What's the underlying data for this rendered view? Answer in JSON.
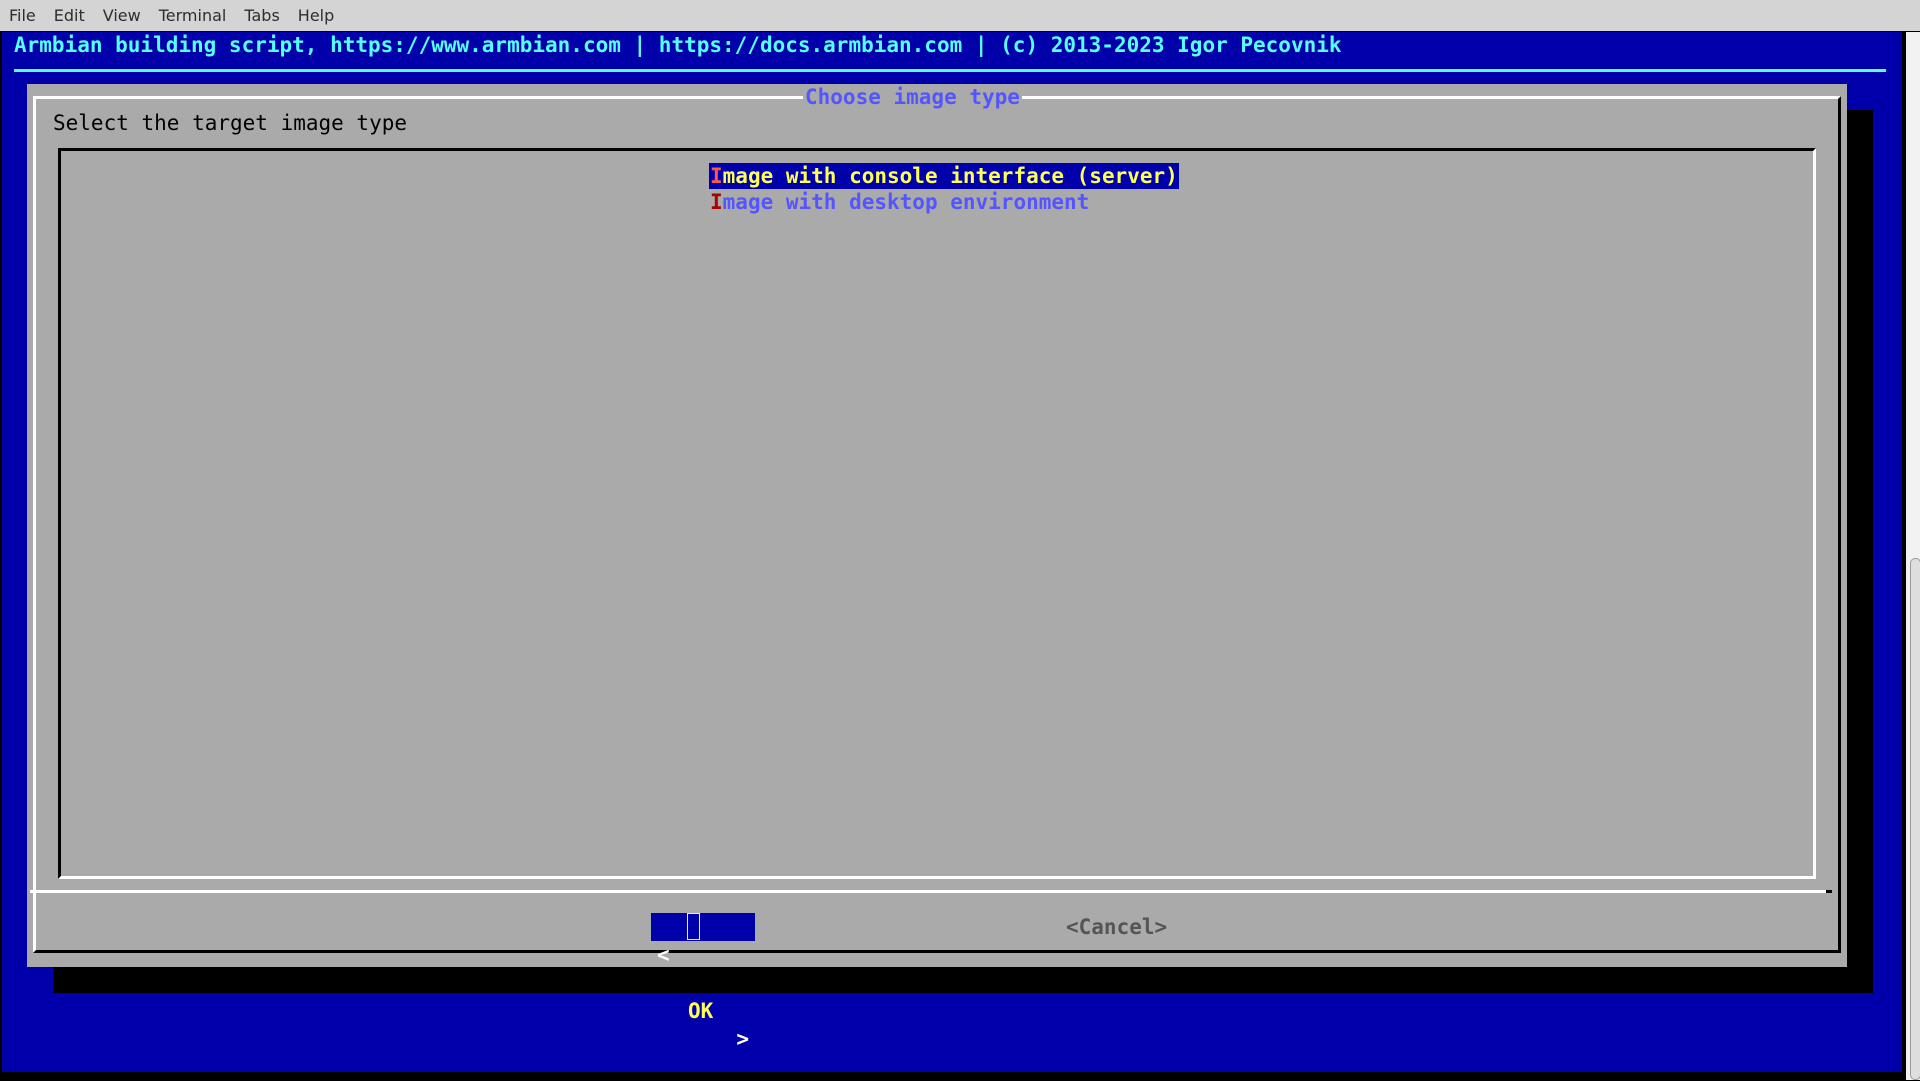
{
  "menubar": {
    "items": [
      "File",
      "Edit",
      "View",
      "Terminal",
      "Tabs",
      "Help"
    ]
  },
  "backtitle": "Armbian building script, https://www.armbian.com | https://docs.armbian.com | (c) 2013-2023 Igor Pecovnik",
  "dialog": {
    "title": "Choose image type",
    "prompt": "Select the target image type",
    "items": [
      {
        "hotkey": "I",
        "rest": "mage with console interface (server)",
        "selected": true
      },
      {
        "hotkey": "I",
        "rest": "mage with desktop environment",
        "selected": false
      }
    ],
    "buttons": {
      "ok": {
        "left": "<",
        "label": "OK",
        "right": ">"
      },
      "cancel": "<Cancel>"
    }
  },
  "colors": {
    "terminal_bg": "#0000aa",
    "dialog_bg": "#aaaaaa",
    "backtitle": "#55ffff",
    "title": "#5555ff",
    "selected_fg": "#ffff55",
    "hotkey": "#aa0000"
  }
}
